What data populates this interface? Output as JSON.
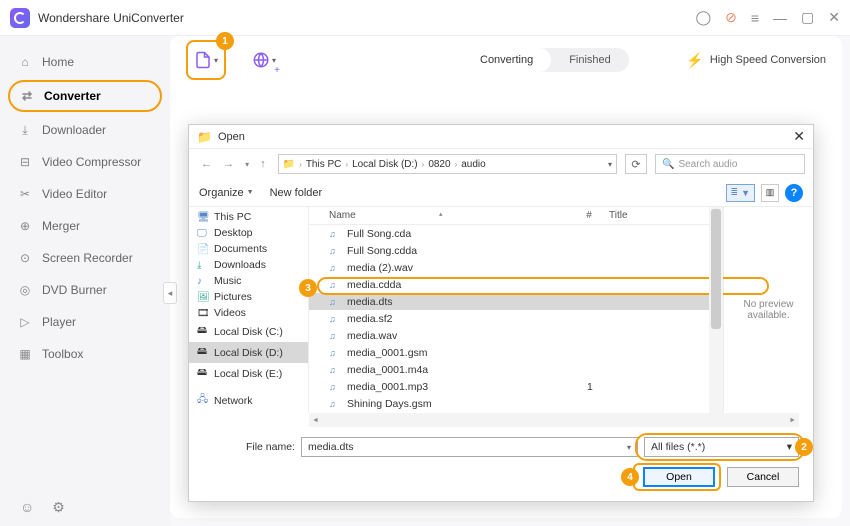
{
  "app_title": "Wondershare UniConverter",
  "sidebar": {
    "items": [
      {
        "label": "Home",
        "icon": "home"
      },
      {
        "label": "Converter",
        "icon": "converter"
      },
      {
        "label": "Downloader",
        "icon": "download"
      },
      {
        "label": "Video Compressor",
        "icon": "compress"
      },
      {
        "label": "Video Editor",
        "icon": "scissors"
      },
      {
        "label": "Merger",
        "icon": "merge"
      },
      {
        "label": "Screen Recorder",
        "icon": "record"
      },
      {
        "label": "DVD Burner",
        "icon": "disc"
      },
      {
        "label": "Player",
        "icon": "play"
      },
      {
        "label": "Toolbox",
        "icon": "grid"
      }
    ]
  },
  "tabs": {
    "converting": "Converting",
    "finished": "Finished"
  },
  "hsc": "High Speed Conversion",
  "badges": {
    "b1": "1",
    "b2": "2",
    "b3": "3",
    "b4": "4"
  },
  "dialog": {
    "title": "Open",
    "crumbs": [
      "This PC",
      "Local Disk (D:)",
      "0820",
      "audio"
    ],
    "search_placeholder": "Search audio",
    "organize": "Organize",
    "new_folder": "New folder",
    "columns": {
      "name": "Name",
      "num": "#",
      "title": "Title"
    },
    "tree": [
      {
        "label": "This PC",
        "icon": "pc"
      },
      {
        "label": "Desktop",
        "icon": "desktop"
      },
      {
        "label": "Documents",
        "icon": "doc"
      },
      {
        "label": "Downloads",
        "icon": "dl"
      },
      {
        "label": "Music",
        "icon": "music"
      },
      {
        "label": "Pictures",
        "icon": "pic"
      },
      {
        "label": "Videos",
        "icon": "vid"
      },
      {
        "label": "Local Disk (C:)",
        "icon": "drive"
      },
      {
        "label": "Local Disk (D:)",
        "icon": "drive"
      },
      {
        "label": "Local Disk (E:)",
        "icon": "drive"
      },
      {
        "label": "Network",
        "icon": "net"
      }
    ],
    "files": [
      {
        "name": "Full Song.cda",
        "num": ""
      },
      {
        "name": "Full Song.cdda",
        "num": ""
      },
      {
        "name": "media (2).wav",
        "num": ""
      },
      {
        "name": "media.cdda",
        "num": ""
      },
      {
        "name": "media.dts",
        "num": ""
      },
      {
        "name": "media.sf2",
        "num": ""
      },
      {
        "name": "media.wav",
        "num": ""
      },
      {
        "name": "media_0001.gsm",
        "num": ""
      },
      {
        "name": "media_0001.m4a",
        "num": ""
      },
      {
        "name": "media_0001.mp3",
        "num": "1"
      },
      {
        "name": "Shining Days.gsm",
        "num": ""
      }
    ],
    "preview": "No preview available.",
    "filename_label": "File name:",
    "filename_value": "media.dts",
    "filetype_value": "All files (*.*)",
    "open": "Open",
    "cancel": "Cancel"
  }
}
